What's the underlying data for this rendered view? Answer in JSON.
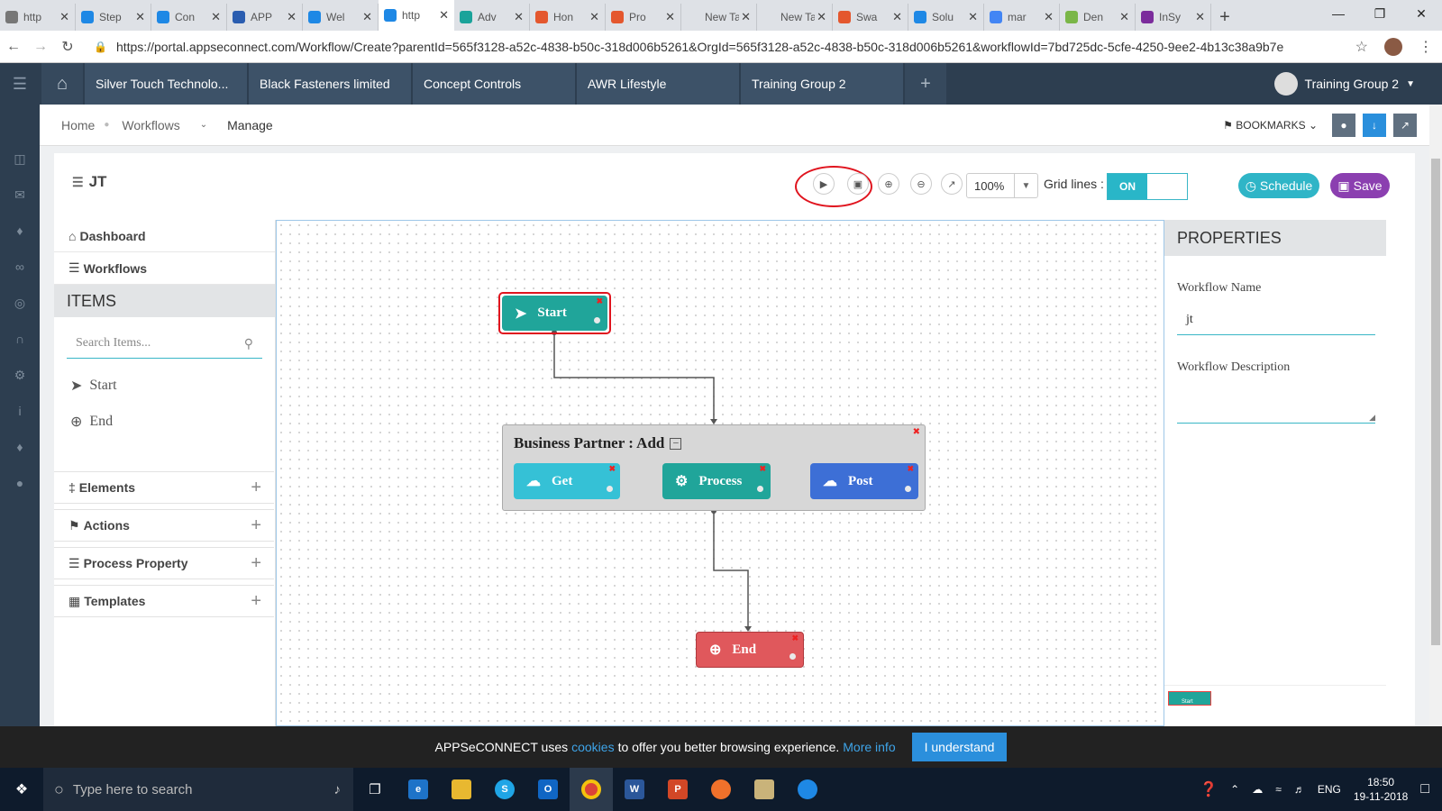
{
  "browser": {
    "tabs": [
      {
        "label": "http",
        "fav_color": "#777777"
      },
      {
        "label": "Step",
        "fav_color": "#1e88e5"
      },
      {
        "label": "Con",
        "fav_color": "#1e88e5"
      },
      {
        "label": "APP",
        "fav_color": "#2a5db0"
      },
      {
        "label": "Wel",
        "fav_color": "#1e88e5"
      },
      {
        "label": "http",
        "fav_color": "#1e88e5",
        "active": true
      },
      {
        "label": "Adv",
        "fav_color": "#1aa39a"
      },
      {
        "label": "Hon",
        "fav_color": "#e4572e"
      },
      {
        "label": "Pro",
        "fav_color": "#e4572e"
      },
      {
        "label": "New Tab",
        "fav_color": ""
      },
      {
        "label": "New Tab",
        "fav_color": ""
      },
      {
        "label": "Swa",
        "fav_color": "#e4572e"
      },
      {
        "label": "Solu",
        "fav_color": "#1e88e5"
      },
      {
        "label": "mar",
        "fav_color": "#4285f4"
      },
      {
        "label": "Den",
        "fav_color": "#7ab648"
      },
      {
        "label": "InSy",
        "fav_color": "#7b2c9c"
      }
    ],
    "url": "https://portal.appseconnect.com/Workflow/Create?parentId=565f3128-a52c-4838-b50c-318d006b5261&OrgId=565f3128-a52c-4838-b50c-318d006b5261&workflowId=7bd725dc-5cfe-4250-9ee2-4b13c38a9b7e"
  },
  "header": {
    "orgs": [
      "Silver Touch Technolo...",
      "Black Fasteners limited",
      "Concept Controls",
      "AWR Lifestyle",
      "Training Group 2"
    ],
    "user": "Training Group 2"
  },
  "breadcrumb": {
    "home": "Home",
    "workflows": "Workflows",
    "current": "Manage",
    "bookmarks": "BOOKMARKS"
  },
  "workflow": {
    "title": "JT",
    "zoom": "100%",
    "grid_label": "Grid lines :",
    "grid_state": "ON",
    "schedule": "Schedule",
    "save": "Save"
  },
  "left_panel": {
    "dashboard": "Dashboard",
    "workflows": "Workflows",
    "items_head": "ITEMS",
    "search_placeholder": "Search Items...",
    "items": [
      "Start",
      "End"
    ],
    "sections": [
      "Elements",
      "Actions",
      "Process Property",
      "Templates"
    ]
  },
  "canvas": {
    "start": "Start",
    "end": "End",
    "group_title": "Business Partner : Add",
    "steps": [
      "Get",
      "Process",
      "Post"
    ],
    "minimap_label": "Start"
  },
  "properties": {
    "head": "PROPERTIES",
    "name_label": "Workflow Name",
    "name_value": "jt",
    "desc_label": "Workflow Description",
    "desc_value": ""
  },
  "cookie": {
    "text1": "APPSeCONNECT uses",
    "link1": "cookies",
    "text2": "to offer you better browsing experience.",
    "link2": "More info",
    "button": "I understand"
  },
  "taskbar": {
    "search": "Type here to search",
    "lang": "ENG",
    "time": "18:50",
    "date": "19-11-2018"
  },
  "colors": {
    "teal": "#20a59a",
    "cyan": "#35c1d6",
    "blue": "#3d6fd6",
    "red": "#e0585c",
    "purple": "#8b3fb0",
    "header": "#2d3e50"
  }
}
